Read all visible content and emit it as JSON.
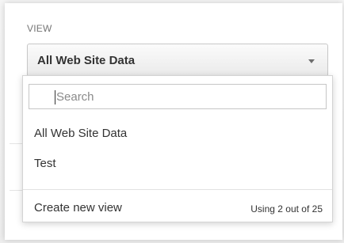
{
  "view_section": {
    "label": "VIEW",
    "selected_value": "All Web Site Data"
  },
  "dropdown": {
    "search_placeholder": "Search",
    "items": [
      {
        "label": "All Web Site Data"
      },
      {
        "label": "Test"
      }
    ],
    "create_label": "Create new view",
    "usage_text": "Using 2 out of 25"
  },
  "colors": {
    "text": "#333333",
    "muted": "#757575",
    "border": "#c8c8c8"
  },
  "icons": {
    "select_toggle": "chevron-down-icon"
  }
}
